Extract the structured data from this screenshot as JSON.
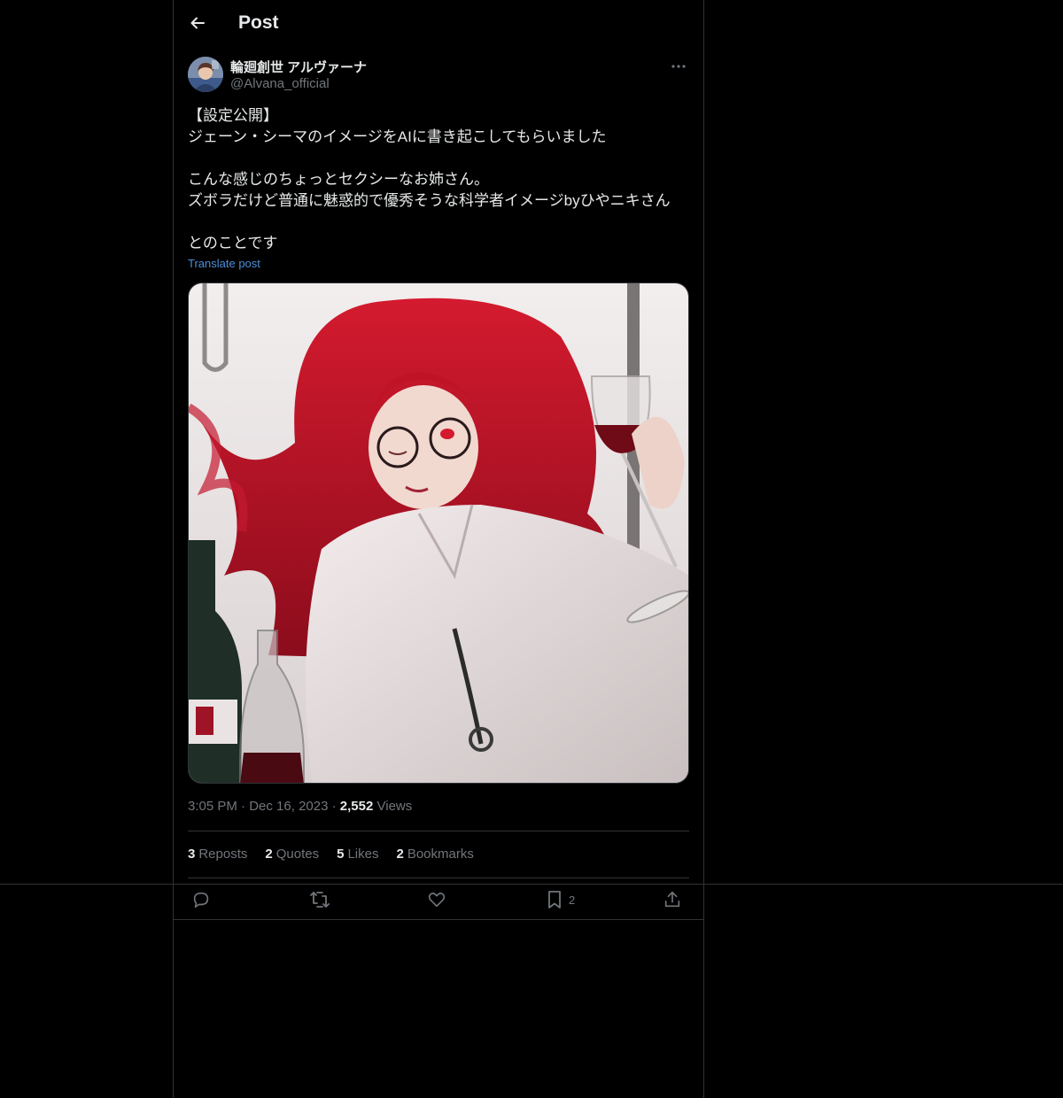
{
  "header": {
    "title": "Post",
    "back_icon": "arrow-left-icon"
  },
  "author": {
    "display_name": "輪廻創世 アルヴァーナ",
    "handle": "@Alvana_official"
  },
  "post": {
    "text": "【設定公開】\nジェーン・シーマのイメージをAIに書き起こしてもらいました\n\nこんな感じのちょっとセクシーなお姉さん。\nズボラだけど普通に魅惑的で優秀そうな科学者イメージbyひやニキさん\n\nとのことです",
    "translate_label": "Translate post"
  },
  "meta": {
    "time": "3:05 PM",
    "date": "Dec 16, 2023",
    "views_count": "2,552",
    "views_label": "Views"
  },
  "stats": {
    "reposts_count": "3",
    "reposts_label": "Reposts",
    "quotes_count": "2",
    "quotes_label": "Quotes",
    "likes_count": "5",
    "likes_label": "Likes",
    "bookmarks_count": "2",
    "bookmarks_label": "Bookmarks"
  },
  "actions": {
    "reply_icon": "reply-icon",
    "repost_icon": "repost-icon",
    "like_icon": "heart-icon",
    "bookmark_icon": "bookmark-icon",
    "bookmark_count": "2",
    "share_icon": "share-icon"
  },
  "colors": {
    "background": "#000000",
    "text": "#e7e9ea",
    "secondary": "#71767b",
    "link": "#4a8fd8",
    "border": "#2f3336"
  }
}
